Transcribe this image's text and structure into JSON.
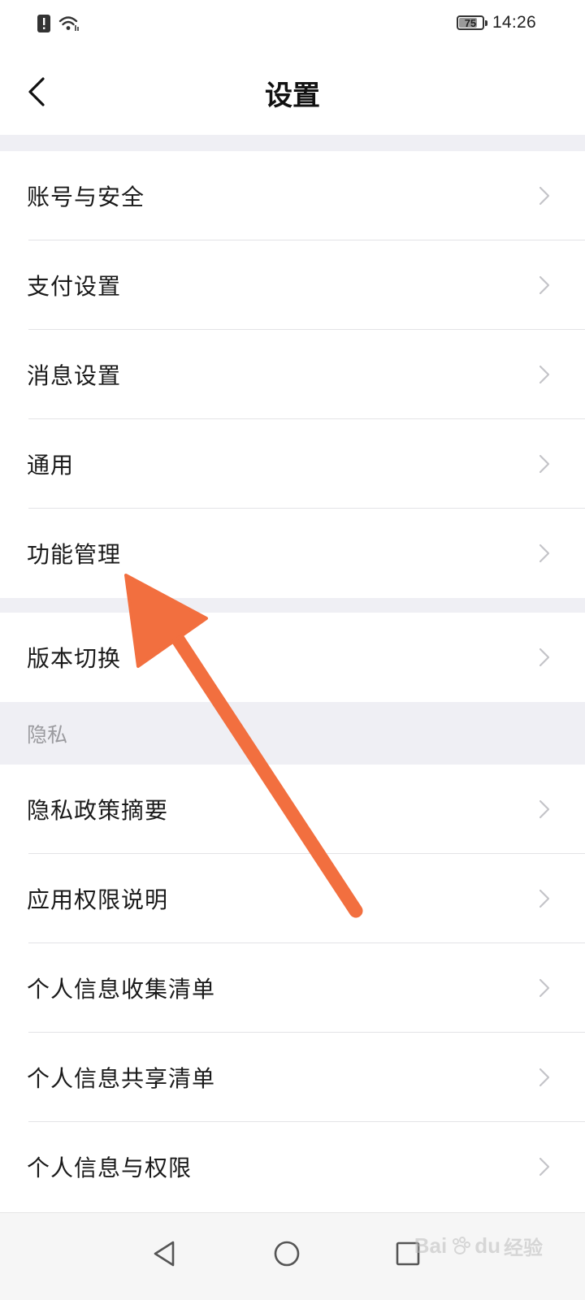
{
  "status_bar": {
    "time": "14:26",
    "battery_level": "75",
    "battery_fraction": 0.75,
    "icons": [
      "alert-icon",
      "wifi-icon"
    ]
  },
  "header": {
    "title": "设置",
    "back_icon": "chevron-left-icon"
  },
  "groups": [
    {
      "items": [
        {
          "label": "账号与安全"
        },
        {
          "label": "支付设置"
        },
        {
          "label": "消息设置"
        },
        {
          "label": "通用"
        },
        {
          "label": "功能管理"
        }
      ]
    },
    {
      "items": [
        {
          "label": "版本切换"
        }
      ]
    }
  ],
  "privacy_section": {
    "title": "隐私",
    "items": [
      {
        "label": "隐私政策摘要"
      },
      {
        "label": "应用权限说明"
      },
      {
        "label": "个人信息收集清单"
      },
      {
        "label": "个人信息共享清单"
      },
      {
        "label": "个人信息与权限"
      }
    ]
  },
  "nav_bar": {
    "buttons": [
      "back-triangle-icon",
      "home-circle-icon",
      "recents-square-icon"
    ]
  },
  "watermark": {
    "text": "Bai",
    "text2": "du",
    "text3": "经验"
  },
  "colors": {
    "annotation_arrow": "#f26f3f",
    "section_bg": "#efeff4",
    "chevron": "#c4c4c8"
  }
}
